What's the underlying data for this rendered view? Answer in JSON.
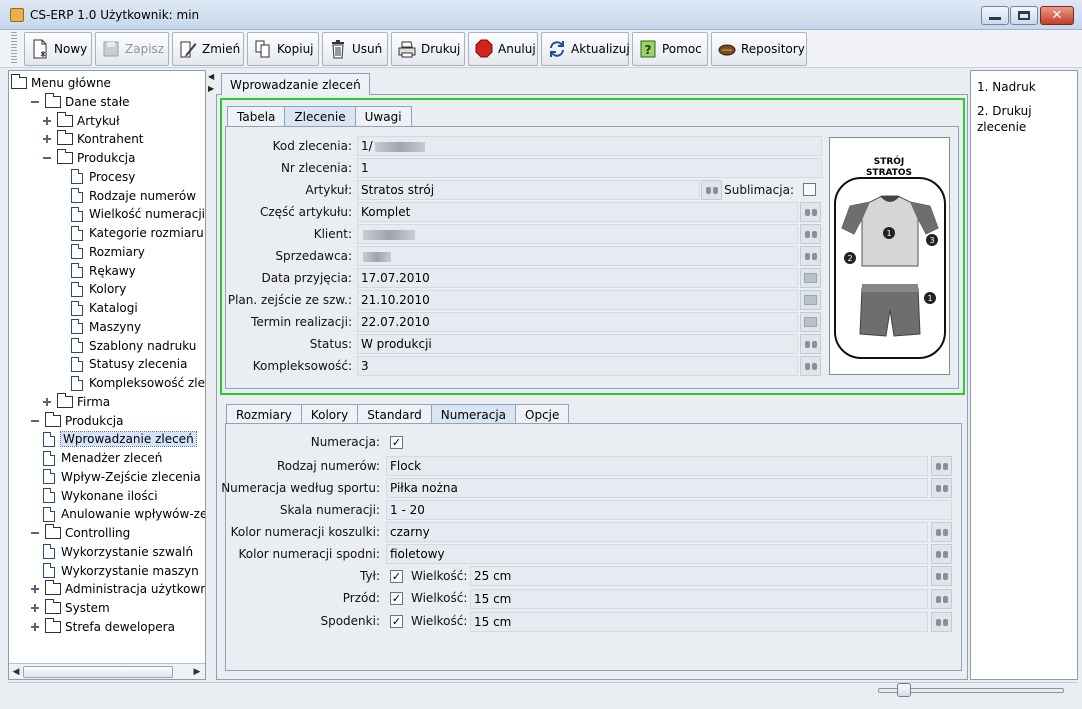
{
  "window": {
    "title": "CS-ERP 1.0  Użytkownik: min"
  },
  "toolbar": {
    "buttons": [
      {
        "label": "Nowy",
        "icon": "new-doc-icon",
        "enabled": true
      },
      {
        "label": "Zapisz",
        "icon": "save-icon",
        "enabled": false
      },
      {
        "label": "Zmień",
        "icon": "edit-icon",
        "enabled": true
      },
      {
        "label": "Kopiuj",
        "icon": "copy-icon",
        "enabled": true
      },
      {
        "label": "Usuń",
        "icon": "trash-icon",
        "enabled": true
      },
      {
        "label": "Drukuj",
        "icon": "print-icon",
        "enabled": true
      },
      {
        "label": "Anuluj",
        "icon": "stop-icon",
        "enabled": true
      },
      {
        "label": "Aktualizuj",
        "icon": "refresh-icon",
        "enabled": true
      },
      {
        "label": "Pomoc",
        "icon": "help-icon",
        "enabled": true
      },
      {
        "label": "Repository",
        "icon": "repository-icon",
        "enabled": true
      }
    ]
  },
  "tree": {
    "nodes": [
      {
        "label": "Menu główne",
        "type": "folder",
        "level": 0
      },
      {
        "label": "Dane stałe",
        "type": "folder",
        "level": 1,
        "expanded": true
      },
      {
        "label": "Artykuł",
        "type": "folder",
        "level": 2,
        "expanded": false
      },
      {
        "label": "Kontrahent",
        "type": "folder",
        "level": 2,
        "expanded": false
      },
      {
        "label": "Produkcja",
        "type": "folder",
        "level": 2,
        "expanded": true
      },
      {
        "label": "Procesy",
        "type": "doc",
        "level": 3
      },
      {
        "label": "Rodzaje numerów",
        "type": "doc",
        "level": 3
      },
      {
        "label": "Wielkość numeracji",
        "type": "doc",
        "level": 3
      },
      {
        "label": "Kategorie rozmiaru",
        "type": "doc",
        "level": 3
      },
      {
        "label": "Rozmiary",
        "type": "doc",
        "level": 3
      },
      {
        "label": "Rękawy",
        "type": "doc",
        "level": 3
      },
      {
        "label": "Kolory",
        "type": "doc",
        "level": 3
      },
      {
        "label": "Katalogi",
        "type": "doc",
        "level": 3
      },
      {
        "label": "Maszyny",
        "type": "doc",
        "level": 3
      },
      {
        "label": "Szablony nadruku",
        "type": "doc",
        "level": 3
      },
      {
        "label": "Statusy zlecenia",
        "type": "doc",
        "level": 3
      },
      {
        "label": "Kompleksowość zlec",
        "type": "doc",
        "level": 3
      },
      {
        "label": "Firma",
        "type": "folder",
        "level": 2,
        "expanded": false
      },
      {
        "label": "Produkcja",
        "type": "folder",
        "level": 1,
        "expanded": true
      },
      {
        "label": "Wprowadzanie zleceń",
        "type": "doc",
        "level": 2,
        "selected": true
      },
      {
        "label": "Menadżer zleceń",
        "type": "doc",
        "level": 2
      },
      {
        "label": "Wpływ-Zejście zlecenia",
        "type": "doc",
        "level": 2
      },
      {
        "label": "Wykonane ilości",
        "type": "doc",
        "level": 2
      },
      {
        "label": "Anulowanie wpływów-zej",
        "type": "doc",
        "level": 2
      },
      {
        "label": "Controlling",
        "type": "folder",
        "level": 1,
        "expanded": true
      },
      {
        "label": "Wykorzystanie szwalń",
        "type": "doc",
        "level": 2
      },
      {
        "label": "Wykorzystanie maszyn",
        "type": "doc",
        "level": 2
      },
      {
        "label": "Administracja użytkowników",
        "type": "folder",
        "level": 1,
        "expanded": false
      },
      {
        "label": "System",
        "type": "folder",
        "level": 1,
        "expanded": false
      },
      {
        "label": "Strefa dewelopera",
        "type": "folder",
        "level": 1,
        "expanded": false
      }
    ]
  },
  "main": {
    "tab_label": "Wprowadzanie zleceń"
  },
  "top_tabs": [
    "Tabela",
    "Zlecenie",
    "Uwagi"
  ],
  "form": {
    "kod_label": "Kod zlecenia:",
    "kod_value": "1/",
    "nr_label": "Nr zlecenia:",
    "nr_value": "1",
    "artykul_label": "Artykuł:",
    "artykul_value": "Stratos strój",
    "sublimacja_label": "Sublimacja:",
    "czesc_label": "Część artykułu:",
    "czesc_value": "Komplet",
    "klient_label": "Klient:",
    "sprzedawca_label": "Sprzedawca:",
    "data_label": "Data przyjęcia:",
    "data_value": "17.07.2010",
    "plan_label": "Plan. zejście ze szw.:",
    "plan_value": "21.10.2010",
    "termin_label": "Termin realizacji:",
    "termin_value": "22.07.2010",
    "status_label": "Status:",
    "status_value": "W produkcji",
    "kompl_label": "Kompleksowość:",
    "kompl_value": "3"
  },
  "preview": {
    "title1": "STRÓJ",
    "title2": "STRATOS",
    "markers": [
      "1",
      "2",
      "3",
      "1"
    ]
  },
  "bottom_tabs": [
    "Rozmiary",
    "Kolory",
    "Standard",
    "Numeracja",
    "Opcje"
  ],
  "numeracja": {
    "numeracja_label": "Numeracja:",
    "rodzaj_label": "Rodzaj numerów:",
    "rodzaj_value": "Flock",
    "sport_label": "Numeracja według sportu:",
    "sport_value": "Piłka nożna",
    "skala_label": "Skala numeracji:",
    "skala_value": "1 - 20",
    "koszulki_label": "Kolor numeracji koszulki:",
    "koszulki_value": "czarny",
    "spodni_label": "Kolor numeracji spodni:",
    "spodni_value": "fioletowy",
    "wielkosc_label": "Wielkość:",
    "tyl_label": "Tył:",
    "tyl_value": "25 cm",
    "przod_label": "Przód:",
    "przod_value": "15 cm",
    "spodenki_label": "Spodenki:",
    "spodenki_value": "15 cm"
  },
  "right_panel": {
    "items": [
      "1. Nadruk",
      "2. Drukuj zlecenie"
    ]
  },
  "colors": {
    "highlight_border": "#29cc29"
  }
}
